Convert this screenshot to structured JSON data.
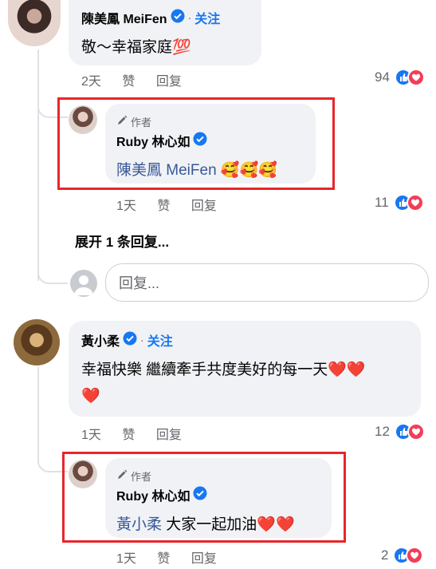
{
  "comments": [
    {
      "author": "陳美鳳 MeiFen",
      "follow": "关注",
      "text": "敬～幸福家庭💯",
      "time": "2天",
      "like": "赞",
      "reply": "回复",
      "count": "94"
    },
    {
      "author": "黃小柔",
      "follow": "关注",
      "text_line1": "幸福快樂 繼續牽手共度美好的每一天❤️❤️",
      "text_line2": "❤️",
      "time": "1天",
      "like": "赞",
      "reply": "回复",
      "count": "12"
    }
  ],
  "replies": [
    {
      "tag": "作者",
      "author": "Ruby 林心如",
      "mention": "陳美鳳 MeiFen",
      "text": " 🥰🥰🥰",
      "time": "1天",
      "like": "赞",
      "reply": "回复",
      "count": "11"
    },
    {
      "tag": "作者",
      "author": "Ruby 林心如",
      "mention": "黃小柔",
      "text": " 大家一起加油❤️❤️",
      "time": "1天",
      "like": "赞",
      "reply": "回复",
      "count": "2"
    }
  ],
  "expand_label": "展开 1 条回复...",
  "reply_placeholder": "回复...",
  "icons": [
    "verified-badge-icon",
    "pencil-icon",
    "like-reaction-icon",
    "love-reaction-icon"
  ],
  "colors": {
    "accent": "#1877f2",
    "highlight": "#e8262a",
    "bubble": "#f0f2f5"
  }
}
